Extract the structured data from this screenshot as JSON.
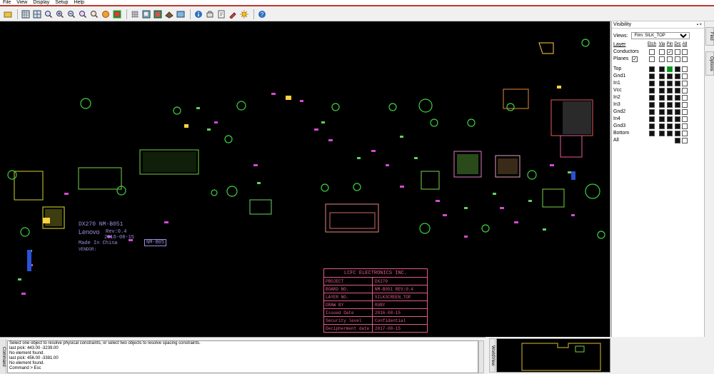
{
  "menu": [
    "File",
    "View",
    "Display",
    "Setup",
    "Help"
  ],
  "toolbar_icons": [
    "open-icon",
    "grid-icon",
    "grid2-icon",
    "zoom-fit-icon",
    "zoom-in-icon",
    "zoom-out-icon",
    "zoom-prev-icon",
    "zoom-icon",
    "refresh-icon",
    "highlight-icon",
    "grid-toggle-icon",
    "layers-icon",
    "properties-icon",
    "3d-icon",
    "color-icon",
    "info-icon",
    "measure-icon",
    "report-icon",
    "paint-icon",
    "sun-icon",
    "help-icon"
  ],
  "visibility": {
    "title": "Visibility",
    "title_controls": "▪ ×",
    "views_label": "Views:",
    "views_value": "Film: SILK_TOP",
    "layer_header": "Layer",
    "columns": [
      "Etch",
      "Via",
      "Pin",
      "Drc",
      "All"
    ],
    "global_rows": [
      {
        "name": "Conductors",
        "checks": [
          false,
          false,
          true,
          false,
          false
        ]
      },
      {
        "name": "Planes",
        "planes_checked": true,
        "checks": [
          false,
          false,
          false,
          false,
          false
        ]
      }
    ],
    "layers": [
      "Top",
      "Gnd1",
      "In1",
      "Vcc",
      "In2",
      "In3",
      "Gnd2",
      "In4",
      "Gnd3",
      "Bottom"
    ],
    "all_label": "All"
  },
  "side_tabs": [
    "Find",
    "Options"
  ],
  "board": {
    "title_block_header": "LCFC ELECTRONICS INC.",
    "rows": [
      {
        "label": "PROJECT",
        "value": "DX270"
      },
      {
        "label": "BOARD NO.",
        "value": "NM-B051 REV:0.4"
      },
      {
        "label": "LAYER NO.",
        "value": "SILKSCREEN_TOP"
      },
      {
        "label": "DRAW BY",
        "value": "RUBY"
      },
      {
        "label": "Issued Date",
        "value": "2016-08-15"
      },
      {
        "label": "Security level",
        "value": "Confidential"
      },
      {
        "label": "Decipherment date",
        "value": "2017-08-15"
      }
    ],
    "silk_model": "DX270  NM-B051",
    "silk_brand": "Lenovo",
    "silk_rev": "Rev:0.4",
    "silk_date": "2016-08-15",
    "silk_made": "Made In China",
    "silk_board_tag": "NM-B05",
    "silk_vendor": "VENDOR:"
  },
  "command": {
    "tab_label": "Command",
    "lines": [
      "Select one object to resolve physical constraints, or select two objects to resolve spacing constraints.",
      "last pick:  443.00 -3239.00",
      "No element found.",
      "last pick:  456.00 -3381.00",
      "No element found.",
      "Command >  Esc"
    ]
  },
  "worldview_label": "WorldView"
}
